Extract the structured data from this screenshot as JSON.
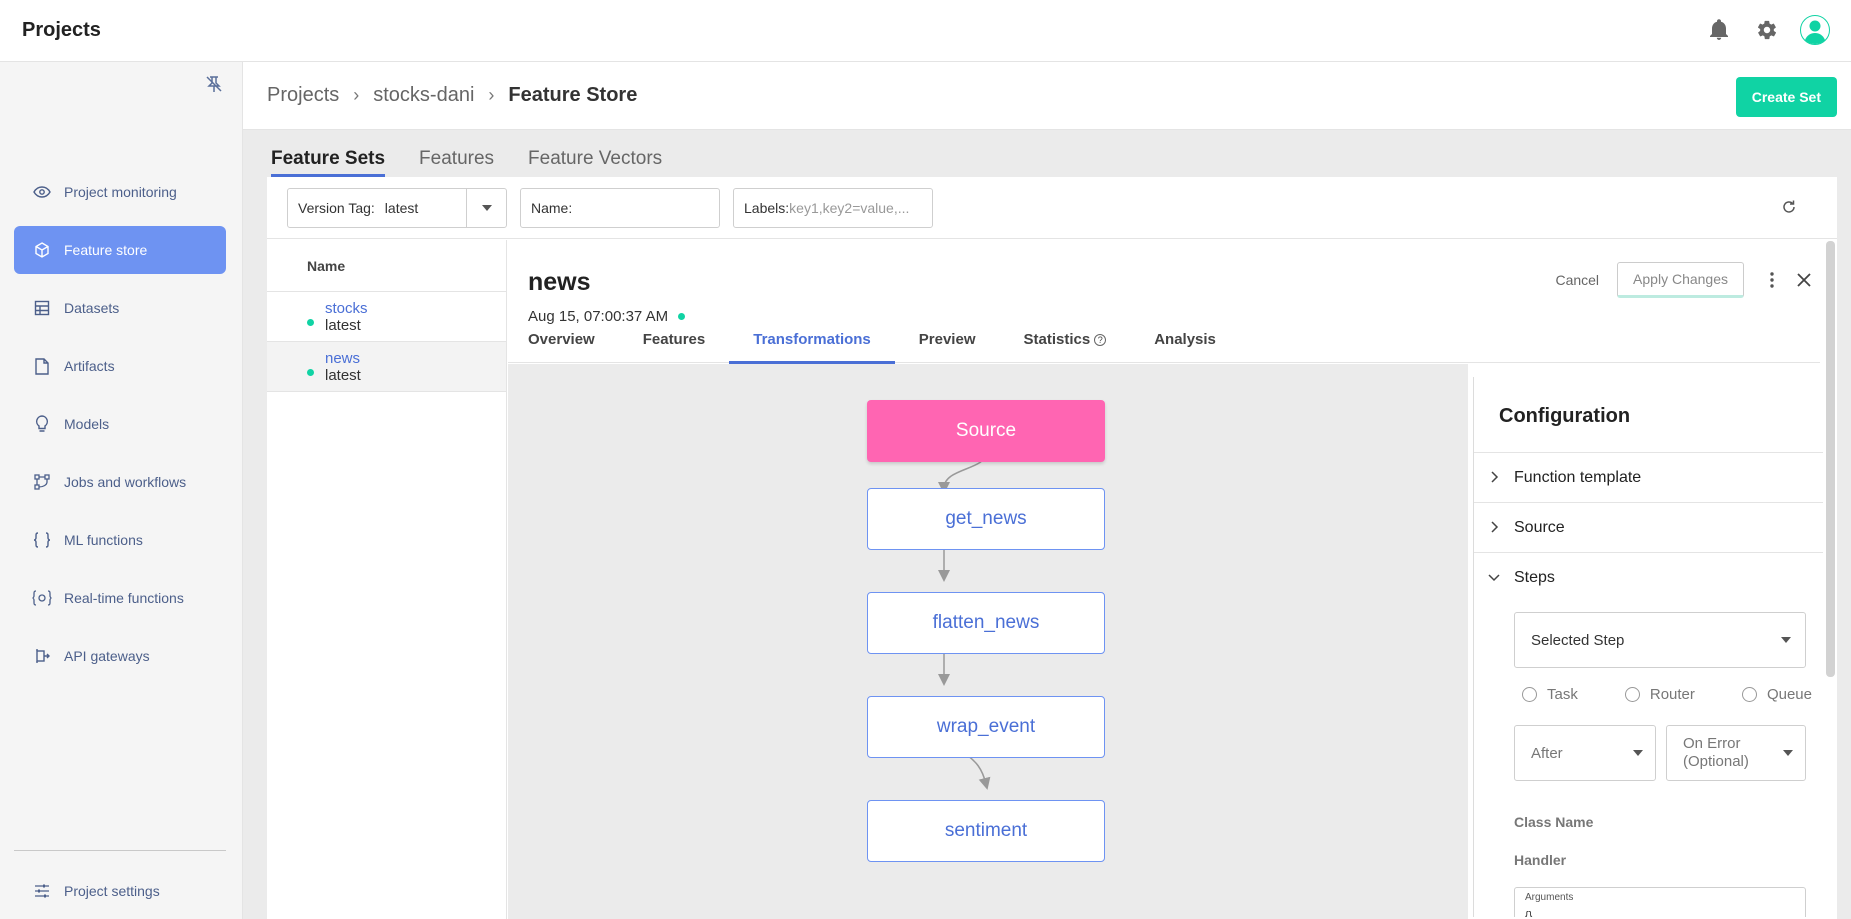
{
  "app": {
    "title": "Projects"
  },
  "sidebar": {
    "items": [
      {
        "label": "Project monitoring",
        "icon": "eye-icon",
        "active": false
      },
      {
        "label": "Feature store",
        "icon": "cube-icon",
        "active": true
      },
      {
        "label": "Datasets",
        "icon": "grid-icon",
        "active": false
      },
      {
        "label": "Artifacts",
        "icon": "file-icon",
        "active": false
      },
      {
        "label": "Models",
        "icon": "lightbulb-icon",
        "active": false
      },
      {
        "label": "Jobs and workflows",
        "icon": "workflow-icon",
        "active": false
      },
      {
        "label": "ML functions",
        "icon": "braces-icon",
        "active": false
      },
      {
        "label": "Real-time functions",
        "icon": "realtime-gear-icon",
        "active": false
      },
      {
        "label": "API gateways",
        "icon": "api-gateway-icon",
        "active": false
      }
    ],
    "settings_label": "Project settings"
  },
  "breadcrumb": [
    "Projects",
    "stocks-dani",
    "Feature Store"
  ],
  "header": {
    "create_label": "Create Set"
  },
  "top_tabs": [
    "Feature Sets",
    "Features",
    "Feature Vectors"
  ],
  "filters": {
    "version_tag_label": "Version Tag:",
    "version_tag_value": "latest",
    "name_label": "Name:",
    "labels_label": "Labels:",
    "labels_placeholder": "key1,key2=value,..."
  },
  "list": {
    "header": "Name",
    "rows": [
      {
        "name": "stocks",
        "version": "latest"
      },
      {
        "name": "news",
        "version": "latest"
      }
    ]
  },
  "detail": {
    "title": "news",
    "date": "Aug 15, 07:00:37 AM",
    "cancel_label": "Cancel",
    "apply_label": "Apply Changes",
    "tabs": [
      "Overview",
      "Features",
      "Transformations",
      "Preview",
      "Statistics",
      "Analysis"
    ],
    "active_tab": "Transformations"
  },
  "graph": {
    "nodes": [
      "Source",
      "get_news",
      "flatten_news",
      "wrap_event",
      "sentiment"
    ]
  },
  "config": {
    "title": "Configuration",
    "sections": [
      "Function template",
      "Source",
      "Steps"
    ],
    "selected_step_label": "Selected Step",
    "step_types": [
      "Task",
      "Router",
      "Queue"
    ],
    "after_label": "After",
    "on_error_label": "On Error (Optional)",
    "class_name_label": "Class Name",
    "handler_label": "Handler",
    "arguments_label": "Arguments",
    "arguments_value": "{}"
  },
  "colors": {
    "accent": "#4a6fd6",
    "nav_active": "#6e93f2",
    "create": "#10d3a4",
    "source_node": "#ff65b2",
    "status_dot": "#10d3a4"
  }
}
